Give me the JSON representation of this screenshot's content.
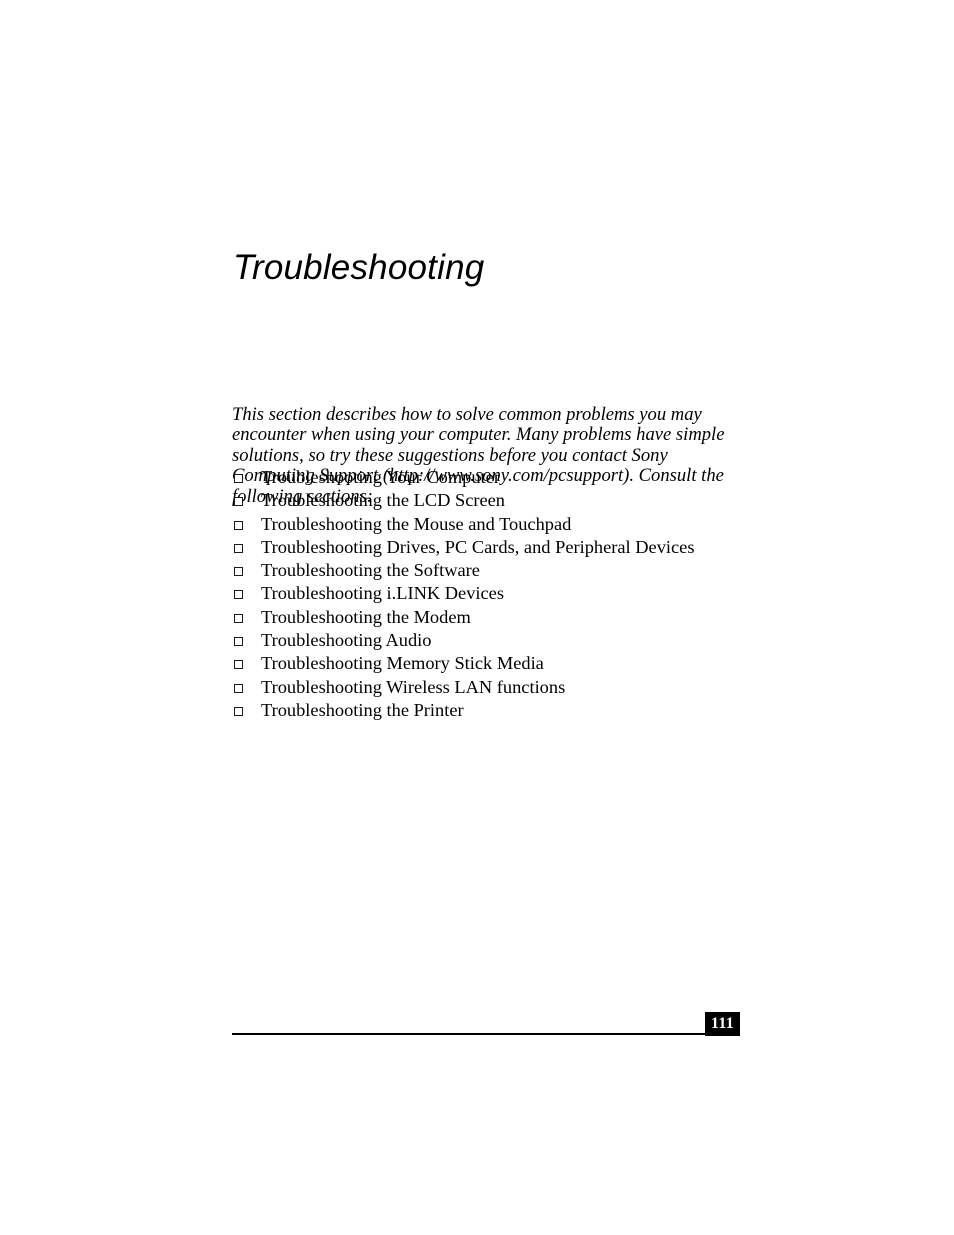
{
  "document": {
    "title": "Troubleshooting",
    "intro_paragraph": "This section describes how to solve common problems you may encounter when using your computer. Many problems have simple solutions, so try these suggestions before you contact Sony Computing Support (http://www.sony.com/pcsupport). Consult the following sections:",
    "sections": [
      {
        "label": "Troubleshooting Your Computer"
      },
      {
        "label": "Troubleshooting the LCD Screen"
      },
      {
        "label": "Troubleshooting the Mouse and Touchpad"
      },
      {
        "label": "Troubleshooting Drives, PC Cards, and Peripheral Devices"
      },
      {
        "label": "Troubleshooting the Software"
      },
      {
        "label": "Troubleshooting i.LINK Devices"
      },
      {
        "label": "Troubleshooting the Modem"
      },
      {
        "label": "Troubleshooting Audio"
      },
      {
        "label": "Troubleshooting Memory Stick Media"
      },
      {
        "label": "Troubleshooting Wireless LAN functions"
      },
      {
        "label": "Troubleshooting the Printer"
      }
    ],
    "footer": {
      "page_number": "111"
    },
    "colors": {
      "text": "#000000",
      "page_background": "#ffffff",
      "page_number_background": "#000000",
      "page_number_text": "#ffffff"
    },
    "icons": {
      "bullet": "hollow-square-bullet-icon"
    }
  }
}
